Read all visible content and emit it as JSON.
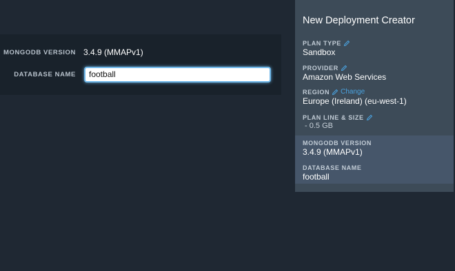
{
  "form": {
    "mongodb_version_label": "MONGODB VERSION",
    "mongodb_version_value": "3.4.9 (MMAPv1)",
    "database_name_label": "DATABASE NAME",
    "database_name_value": "football"
  },
  "summary": {
    "title": "New Deployment Creator",
    "plan_type_label": "PLAN TYPE",
    "plan_type_value": "Sandbox",
    "provider_label": "PROVIDER",
    "provider_value": "Amazon Web Services",
    "region_label": "REGION",
    "region_change_link": "Change",
    "region_value": "Europe (Ireland) (eu-west-1)",
    "plan_line_label": "PLAN LINE & SIZE",
    "plan_line_value": "- 0.5 GB",
    "mongodb_version_label": "MONGODB VERSION",
    "mongodb_version_value": "3.4.9 (MMAPv1)",
    "database_name_label": "DATABASE NAME",
    "database_name_value": "football"
  },
  "icons": {
    "edit": "pencil-icon"
  },
  "colors": {
    "background": "#1f2833",
    "form_panel": "#19222b",
    "summary_panel": "#3d4b58",
    "summary_highlight": "#46566a",
    "link": "#4aa3e0",
    "input_focus": "#6fb7e8"
  }
}
